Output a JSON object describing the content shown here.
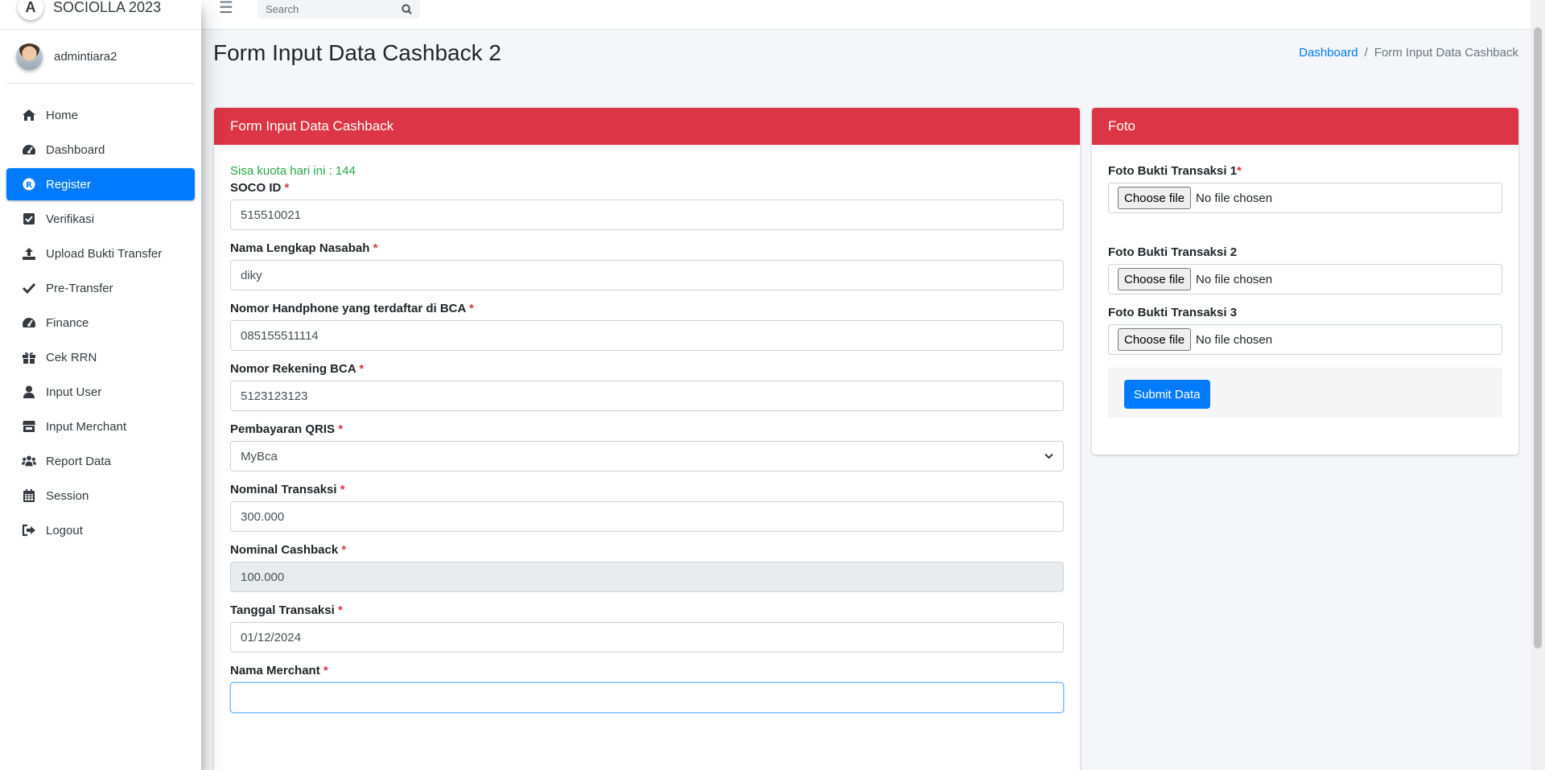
{
  "brand": {
    "name": "SOCIOLLA 2023"
  },
  "user": {
    "name": "admintiara2"
  },
  "sidebar": {
    "items": [
      {
        "label": "Home",
        "icon": "home-icon"
      },
      {
        "label": "Dashboard",
        "icon": "tachometer-icon"
      },
      {
        "label": "Register",
        "icon": "registered-icon",
        "active": true
      },
      {
        "label": "Verifikasi",
        "icon": "check-square-icon"
      },
      {
        "label": "Upload Bukti Transfer",
        "icon": "upload-icon"
      },
      {
        "label": "Pre-Transfer",
        "icon": "check-icon"
      },
      {
        "label": "Finance",
        "icon": "tachometer-icon"
      },
      {
        "label": "Cek RRN",
        "icon": "gift-icon"
      },
      {
        "label": "Input User",
        "icon": "user-icon"
      },
      {
        "label": "Input Merchant",
        "icon": "store-icon"
      },
      {
        "label": "Report Data",
        "icon": "users-icon"
      },
      {
        "label": "Session",
        "icon": "calendar-icon"
      },
      {
        "label": "Logout",
        "icon": "sign-out-icon"
      }
    ]
  },
  "navbar": {
    "search_placeholder": "Search"
  },
  "header": {
    "title": "Form Input Data Cashback 2",
    "breadcrumb": {
      "link": "Dashboard",
      "separator": "/",
      "current": "Form Input Data Cashback"
    }
  },
  "form": {
    "card_title": "Form Input Data Cashback",
    "quota_text": "Sisa kuota hari ini : 144",
    "required_mark": "*",
    "fields": {
      "soco_id": {
        "label": "SOCO ID",
        "value": "515510021"
      },
      "nama": {
        "label": "Nama Lengkap Nasabah",
        "value": "diky"
      },
      "handphone": {
        "label": "Nomor Handphone yang terdaftar di BCA",
        "value": "085155511114"
      },
      "rekening": {
        "label": "Nomor Rekening BCA",
        "value": "5123123123"
      },
      "qris": {
        "label": "Pembayaran QRIS",
        "value": "MyBca"
      },
      "nominal_transaksi": {
        "label": "Nominal Transaksi",
        "value": "300.000"
      },
      "nominal_cashback": {
        "label": "Nominal Cashback",
        "value": "100.000"
      },
      "tanggal": {
        "label": "Tanggal Transaksi",
        "value": "01/12/2024"
      },
      "merchant": {
        "label": "Nama Merchant",
        "value": ""
      }
    }
  },
  "foto": {
    "card_title": "Foto",
    "fields": [
      {
        "label": "Foto Bukti Transaksi 1",
        "required": true
      },
      {
        "label": "Foto Bukti Transaksi 2",
        "required": false
      },
      {
        "label": "Foto Bukti Transaksi 3",
        "required": false
      }
    ],
    "choose_label": "Choose file",
    "no_file_text": "No file chosen",
    "submit_label": "Submit Data"
  },
  "colors": {
    "primary": "#007bff",
    "danger": "#dc3545",
    "success": "#28a745"
  }
}
